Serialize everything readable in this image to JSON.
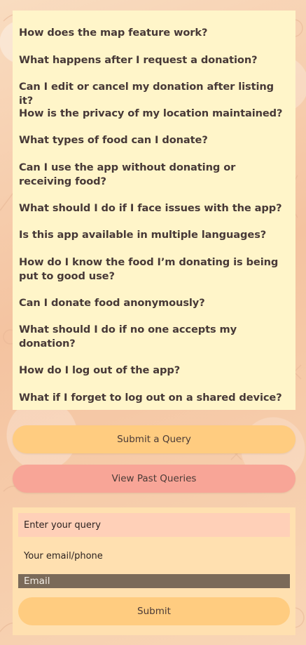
{
  "faq": {
    "items": [
      "How does the map feature work?",
      "What happens after I request a donation?",
      "Can I edit or cancel my donation after listing it?",
      "How is the privacy of my location maintained?",
      "What types of food can I donate?",
      "Can I use the app without donating or receiving food?",
      "What should I do if I face issues with the app?",
      "Is this app available in multiple languages?",
      "How do I know the food I’m donating is being put to good use?",
      "Can I donate food anonymously?",
      "What should I do if no one accepts my donation?",
      "How do I log out of the app?",
      "What if I forget to log out on a shared device?"
    ]
  },
  "actions": {
    "submit_query_label": "Submit a Query",
    "view_past_label": "View Past Queries"
  },
  "form": {
    "query_placeholder": "Enter your query",
    "contact_placeholder": "Your email/phone",
    "email_value": "Email",
    "submit_label": "Submit"
  },
  "colors": {
    "faq_background": "#fff5c9",
    "primary_button": "#ffcc80",
    "secondary_button": "#f8a597",
    "form_background": "#ffe0b0"
  }
}
